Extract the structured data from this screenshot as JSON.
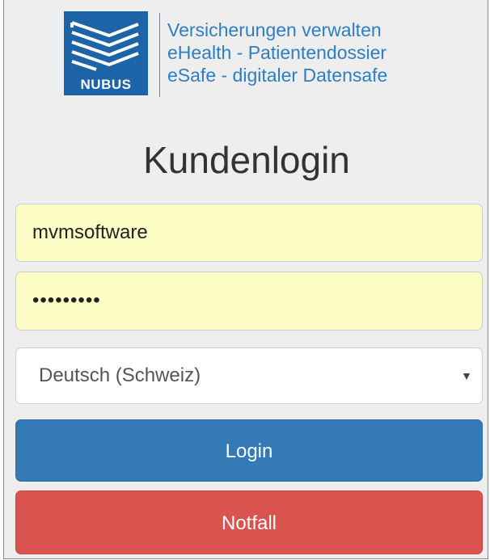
{
  "brand": {
    "logo_text": "NUBUS",
    "tagline": [
      "Versicherungen verwalten",
      "eHealth - Patientendossier",
      "eSafe - digitaler Datensafe"
    ]
  },
  "login": {
    "title": "Kundenlogin",
    "username_value": "mvmsoftware",
    "password_masked": "•••••••••",
    "language_selected": "Deutsch (Schweiz)",
    "login_label": "Login",
    "emergency_label": "Notfall"
  },
  "colors": {
    "brand_blue": "#1d63a8",
    "tagline_blue": "#2d7ec4",
    "autofill_yellow": "#fbfdc5",
    "login_blue": "#337ab7",
    "emergency_red": "#d9534f"
  },
  "icons": {
    "logo": "stacked-layers-logo-icon",
    "select": "caret-down-icon"
  }
}
